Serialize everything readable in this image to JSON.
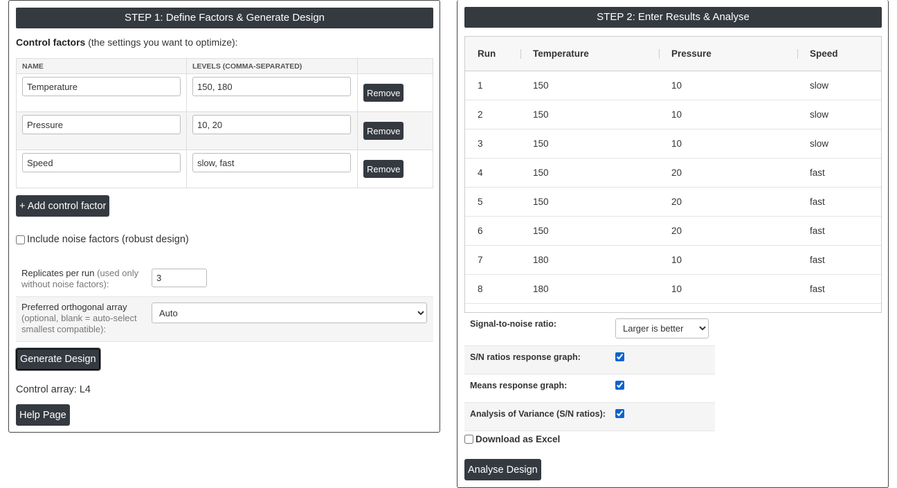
{
  "step1": {
    "header": "STEP 1: Define Factors & Generate Design",
    "intro_bold": "Control factors",
    "intro_rest": " (the settings you want to optimize):",
    "table_headers": {
      "name": "NAME",
      "levels": "LEVELS (COMMA-SEPARATED)",
      "actions": ""
    },
    "factors": [
      {
        "name": "Temperature",
        "levels": "150, 180",
        "remove": "Remove"
      },
      {
        "name": "Pressure",
        "levels": "10, 20",
        "remove": "Remove"
      },
      {
        "name": "Speed",
        "levels": "slow, fast",
        "remove": "Remove"
      }
    ],
    "add_factor_label": "+ Add control factor",
    "noise_label": "Include noise factors (robust design)",
    "noise_checked": false,
    "replicates_label": "Replicates per run",
    "replicates_note": " (used only without noise factors):",
    "replicates_value": "3",
    "array_label": "Preferred orthogonal array",
    "array_note": "(optional, blank = auto-select smallest compatible):",
    "array_selected": "Auto",
    "generate_label": "Generate Design",
    "control_array_text": "Control array: L4",
    "help_label": "Help Page"
  },
  "step2": {
    "header": "STEP 2: Enter Results & Analyse",
    "columns": [
      "Run",
      "Temperature",
      "Pressure",
      "Speed"
    ],
    "rows": [
      [
        "1",
        "150",
        "10",
        "slow"
      ],
      [
        "2",
        "150",
        "10",
        "slow"
      ],
      [
        "3",
        "150",
        "10",
        "slow"
      ],
      [
        "4",
        "150",
        "20",
        "fast"
      ],
      [
        "5",
        "150",
        "20",
        "fast"
      ],
      [
        "6",
        "150",
        "20",
        "fast"
      ],
      [
        "7",
        "180",
        "10",
        "fast"
      ],
      [
        "8",
        "180",
        "10",
        "fast"
      ]
    ],
    "sn_label": "Signal-to-noise ratio:",
    "sn_selected": "Larger is better",
    "sn_graph_label": "S/N ratios response graph:",
    "means_graph_label": "Means response graph:",
    "anova_label": "Analysis of Variance (S/N ratios):",
    "excel_label": "Download as Excel",
    "analyse_label": "Analyse Design"
  },
  "colors": {
    "header_bg": "#343a40",
    "button_bg": "#343a40",
    "check_accent": "#0b63ce"
  }
}
